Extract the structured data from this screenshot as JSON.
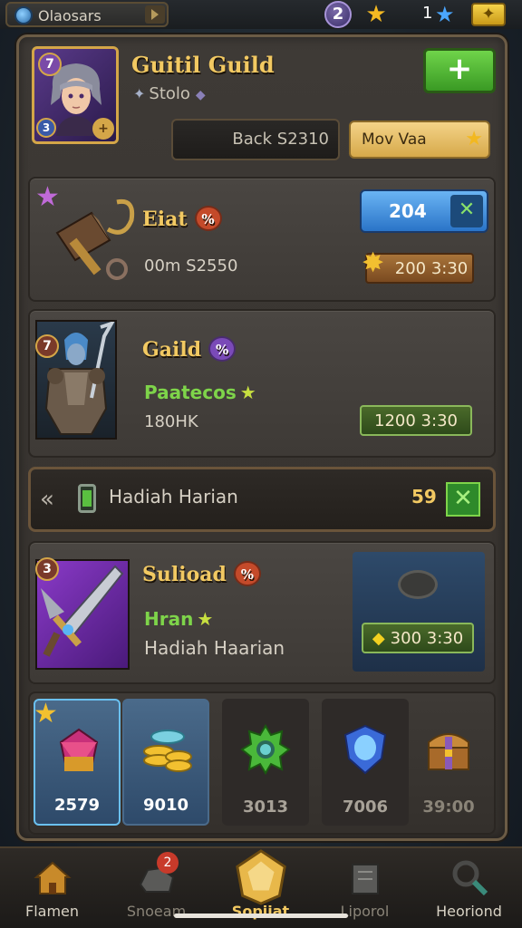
{
  "topbar": {
    "title": "Olaosars",
    "level": "2",
    "count": "1"
  },
  "header": {
    "guild_name": "Guitil Guild",
    "subtitle": "Stolo",
    "avatar_level": "7",
    "avatar_rank": "3",
    "back_label": "Back S2310",
    "move_label": "Mov Vaa",
    "add_label": "+"
  },
  "cards": [
    {
      "title": "Eiat",
      "badge": "%",
      "meta": "00m S2550",
      "value_button": "204",
      "timer": "200 3:30"
    },
    {
      "title": "Gaild",
      "badge": "%",
      "level": "7",
      "status": "Paatecos",
      "meta": "180HK",
      "timer": "1200 3:30"
    },
    {
      "title": "Sulioad",
      "badge": "%",
      "level": "3",
      "status": "Hran",
      "meta": "Hadiah Haarian",
      "timer": "300 3:30"
    }
  ],
  "reward_strip": {
    "label": "Hadiah Harian",
    "count": "59"
  },
  "items": [
    {
      "value": "2579",
      "icon": "red-gem-icon"
    },
    {
      "value": "9010",
      "icon": "gold-coins-icon"
    },
    {
      "value": "3013",
      "icon": "green-gear-icon"
    },
    {
      "value": "7006",
      "icon": "blue-shield-icon"
    },
    {
      "value": "39:00",
      "icon": "treasure-chest-icon"
    }
  ],
  "nav": [
    {
      "label": "Flamen",
      "icon": "house-icon"
    },
    {
      "label": "Snoeam",
      "icon": "rock-icon",
      "badge": "2"
    },
    {
      "label": "Sopiiat",
      "icon": "guild-crest-icon"
    },
    {
      "label": "Liporol",
      "icon": "book-icon"
    },
    {
      "label": "Heoriond",
      "icon": "magnifier-icon"
    }
  ],
  "colors": {
    "gold_title": "#f2c962",
    "green_accent": "#6fd44a",
    "blue_accent": "#4a9ae8",
    "panel_border": "#6b5b45"
  }
}
